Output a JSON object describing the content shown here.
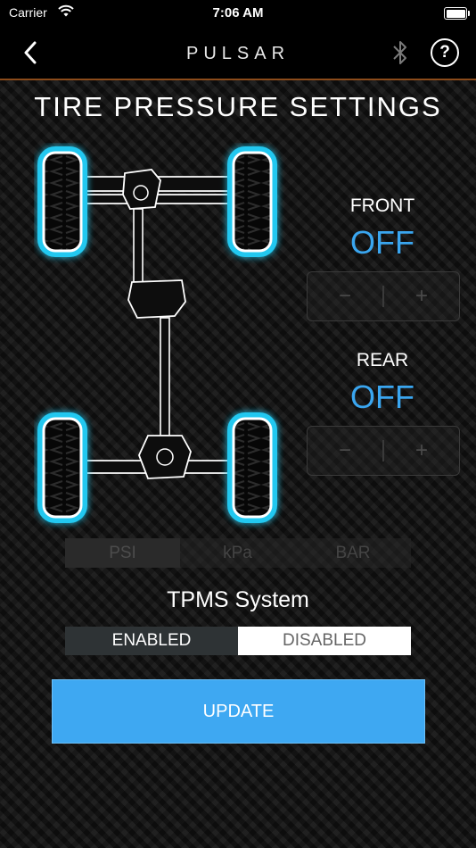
{
  "status_bar": {
    "carrier": "Carrier",
    "time": "7:06 AM"
  },
  "nav": {
    "logo": "PULSAR",
    "help_label": "?"
  },
  "page": {
    "title": "TIRE PRESSURE SETTINGS"
  },
  "front": {
    "label": "FRONT",
    "value": "OFF",
    "minus": "−",
    "plus": "+"
  },
  "rear": {
    "label": "REAR",
    "value": "OFF",
    "minus": "−",
    "plus": "+"
  },
  "units": {
    "options": [
      "PSI",
      "kPa",
      "BAR"
    ],
    "selected": "PSI"
  },
  "tpms": {
    "title": "TPMS System",
    "enabled_label": "ENABLED",
    "disabled_label": "DISABLED",
    "selected": "ENABLED"
  },
  "update_label": "UPDATE",
  "colors": {
    "accent": "#3ea8f2",
    "tire_glow": "#22c8f0",
    "nav_divider": "#8a4a1a"
  }
}
